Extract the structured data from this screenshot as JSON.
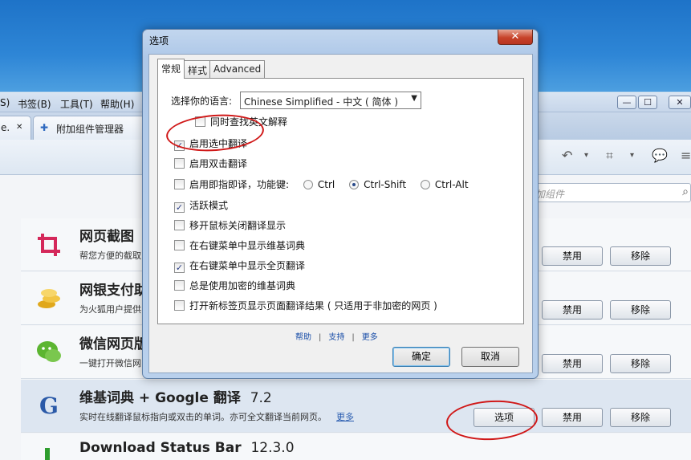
{
  "menu": [
    "S)",
    "书签(B)",
    "工具(T)",
    "帮助(H)"
  ],
  "window_controls": [
    "—",
    "☐",
    "✕"
  ],
  "tabs": [
    {
      "label": "e.",
      "close": "✕"
    },
    {
      "label": "附加组件管理器"
    }
  ],
  "search_placeholder": "加组件",
  "addons": [
    {
      "name": "网页截图",
      "version": "",
      "desc": "帮您方便的截取",
      "buttons": [
        "禁用",
        "移除"
      ]
    },
    {
      "name": "网银支付助",
      "version": "",
      "desc": "为火狐用户提供",
      "buttons": [
        "禁用",
        "移除"
      ]
    },
    {
      "name": "微信网页版",
      "version": "",
      "desc": "一键打开微信网",
      "buttons": [
        "禁用",
        "移除"
      ]
    },
    {
      "name": "维基词典 + Google 翻译",
      "version": "7.2",
      "desc": "实时在线翻译鼠标指向或双击的单词。亦可全文翻译当前网页。",
      "more": "更多",
      "buttons": [
        "选项",
        "禁用",
        "移除"
      ]
    },
    {
      "name": "Download Status Bar",
      "version": "12.3.0",
      "desc": ""
    }
  ],
  "dialog": {
    "title": "选项",
    "close": "✕",
    "tabs": [
      "常规",
      "样式",
      "Advanced"
    ],
    "lang_label": "选择你的语言:",
    "lang_value": "Chinese Simplified - 中文 ( 简体 )",
    "options": [
      {
        "label": "同时查找英文解释",
        "checked": false
      },
      {
        "label": "启用选中翻译",
        "checked": true
      },
      {
        "label": "启用双击翻译",
        "checked": false
      },
      {
        "label": "启用即指即译，功能键:",
        "checked": false
      },
      {
        "label": "活跃模式",
        "checked": true
      },
      {
        "label": "移开鼠标关闭翻译显示",
        "checked": false
      },
      {
        "label": "在右键菜单中显示维基词典",
        "checked": false
      },
      {
        "label": "在右键菜单中显示全页翻译",
        "checked": true
      },
      {
        "label": "总是使用加密的维基词典",
        "checked": false
      },
      {
        "label": "打开新标签页显示页面翻译结果 ( 只适用于非加密的网页 )",
        "checked": false
      }
    ],
    "hotkeys": [
      "Ctrl",
      "Ctrl-Shift",
      "Ctrl-Alt"
    ],
    "hotkey_selected": "Ctrl-Shift",
    "links": [
      "帮助",
      "支持",
      "更多"
    ],
    "ok": "确定",
    "cancel": "取消"
  },
  "colors": {
    "highlight": "#d01818",
    "link": "#1a4ea8"
  }
}
